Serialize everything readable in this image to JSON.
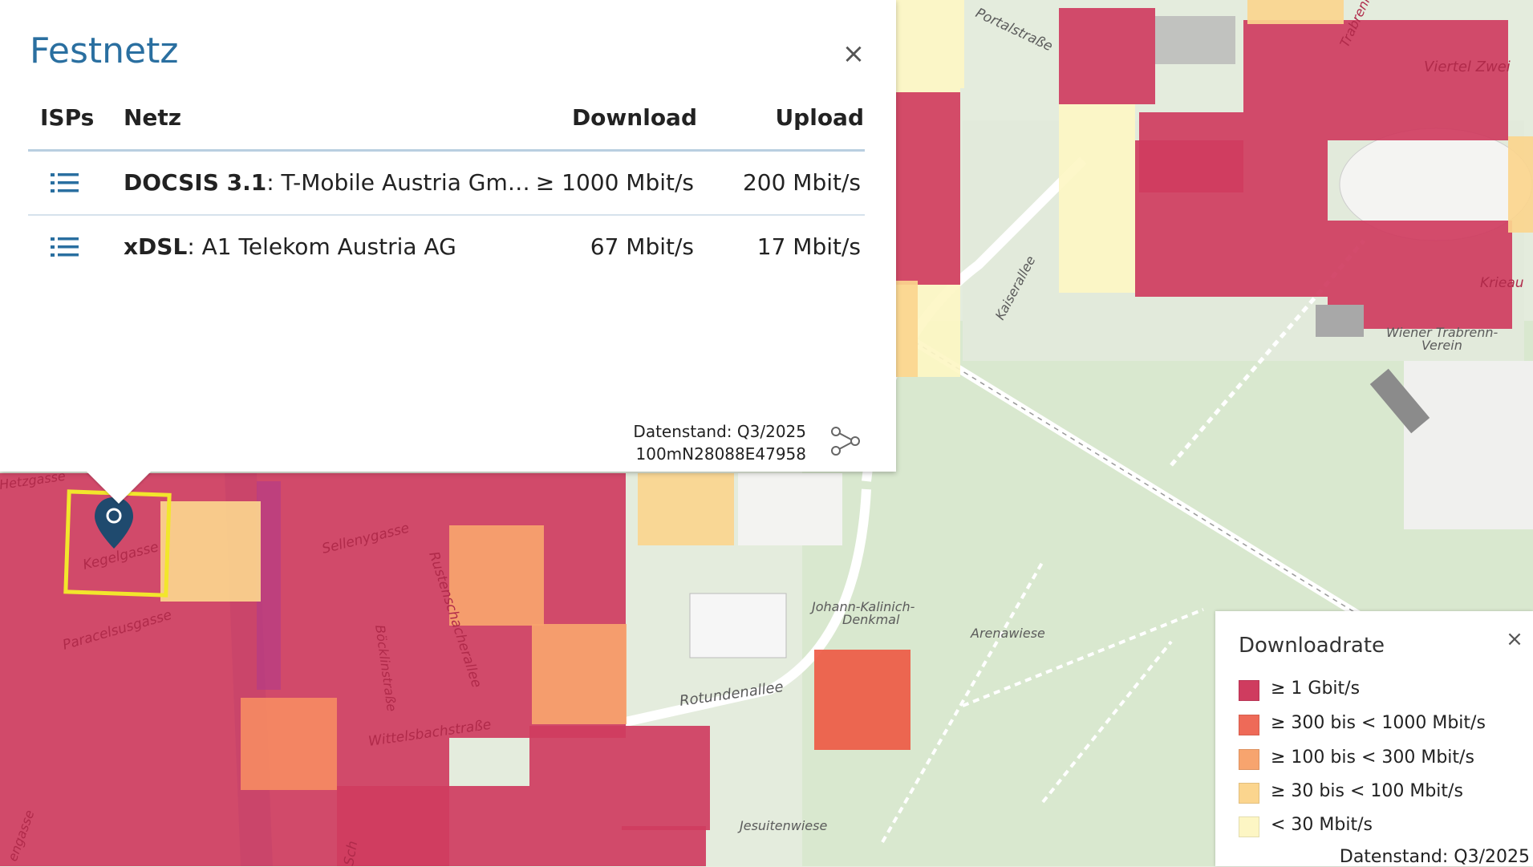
{
  "popup": {
    "title": "Festnetz",
    "close_label": "×",
    "headers": {
      "isps": "ISPs",
      "netz": "Netz",
      "download": "Download",
      "upload": "Upload"
    },
    "rows": [
      {
        "tech": "DOCSIS 3.1",
        "provider": ": T-Mobile Austria Gm…",
        "download": "≥ 1000 Mbit/s",
        "upload": "200 Mbit/s"
      },
      {
        "tech": "xDSL",
        "provider": ": A1 Telekom Austria AG",
        "download": "67 Mbit/s",
        "upload": "17 Mbit/s"
      }
    ],
    "date_line": "Datenstand: Q3/2025",
    "cell_id": "100mN28088E47958"
  },
  "legend": {
    "title": "Downloadrate",
    "close_label": "×",
    "items": [
      {
        "label": "≥ 1 Gbit/s",
        "color": "#cf3c5f"
      },
      {
        "label": "≥ 300 bis < 1000 Mbit/s",
        "color": "#ee6a58"
      },
      {
        "label": "≥ 100 bis < 300 Mbit/s",
        "color": "#f7a46e"
      },
      {
        "label": "≥ 30 bis < 100 Mbit/s",
        "color": "#fbd58e"
      },
      {
        "label": "< 30 Mbit/s",
        "color": "#fdf6c4"
      }
    ],
    "date": "Datenstand: Q3/2025"
  },
  "map_labels": {
    "portalstrasse": "Portalstraße",
    "trabrenn": "Trabrenn",
    "viertel_zwei": "Viertel Zwei",
    "krieau": "Krieau",
    "verein_1": "Wiener Trabrenn-",
    "verein_2": "Verein",
    "kaiserallee": "Kaiserallee",
    "hetzgasse": "Hetzgasse",
    "kegelgasse": "Kegelgasse",
    "sellenygasse": "Sellenygasse",
    "paracelsusgasse": "Paracelsusgasse",
    "rustenschacherallee": "Rustenschacherallee",
    "boecklinstrasse": "Böcklinstraße",
    "rotundenallee": "Rotundenallee",
    "wittelsbachstrasse": "Wittelsbachstraße",
    "johann_1": "Johann-Kalinich-",
    "johann_2": "Denkmal",
    "arenawiese": "Arenawiese",
    "jesuitenwiese": "Jesuitenwiese",
    "schuettel": "Sch",
    "engasse": "engasse"
  }
}
